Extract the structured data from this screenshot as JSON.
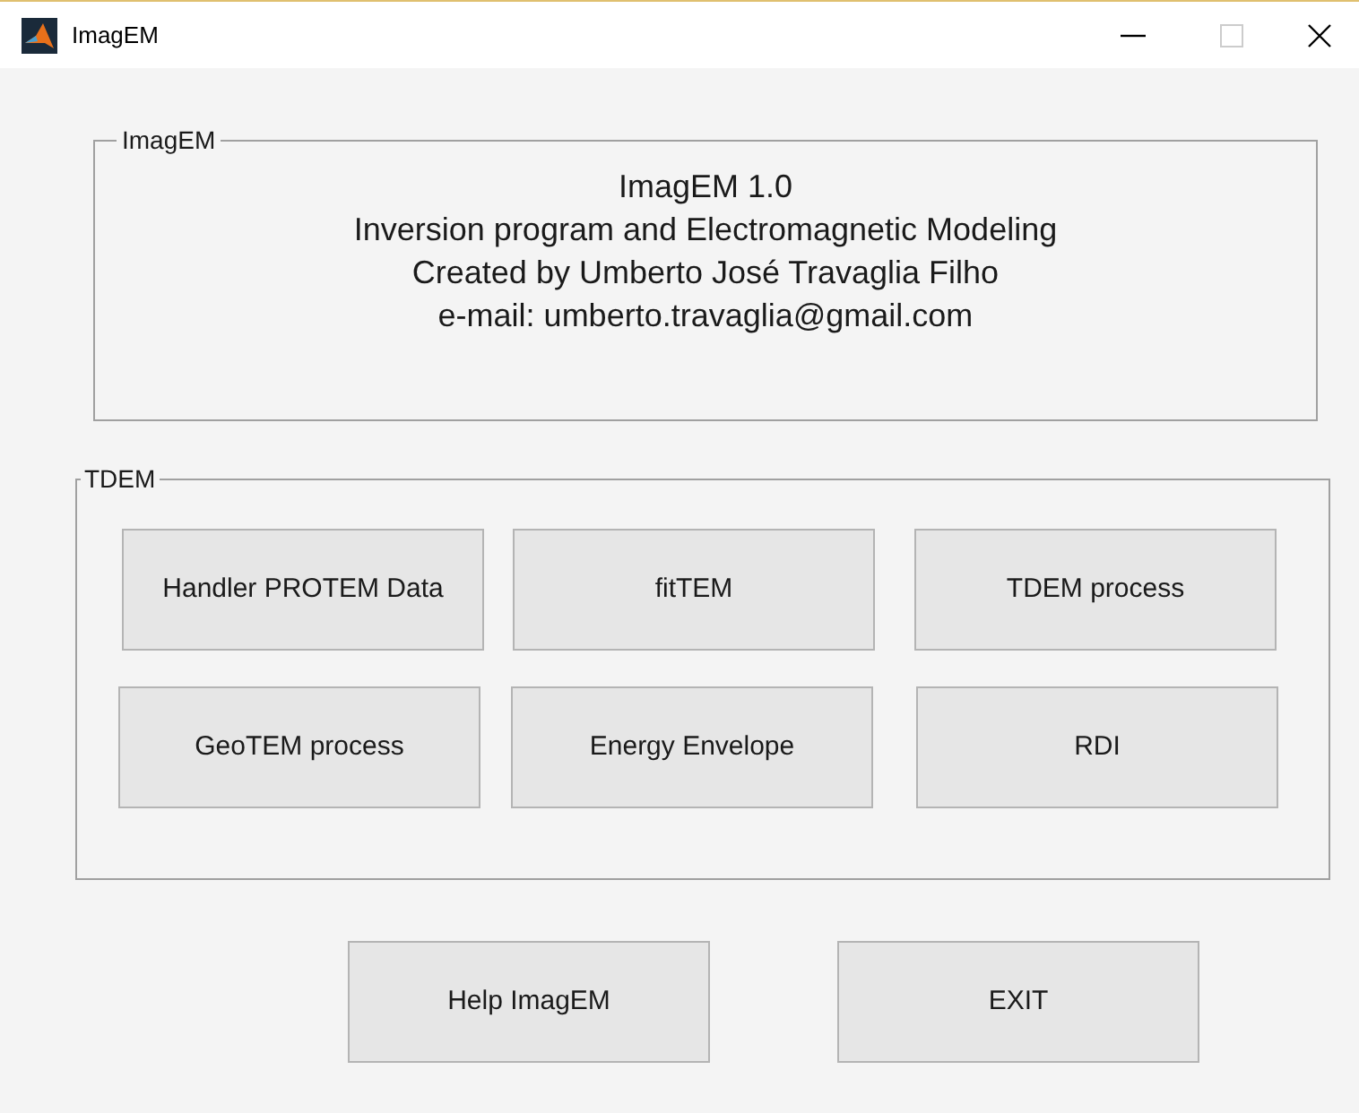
{
  "window": {
    "title": "ImagEM"
  },
  "about_panel": {
    "title": "ImagEM",
    "lines": [
      "ImagEM 1.0",
      "Inversion program and Electromagnetic Modeling",
      "Created by Umberto José Travaglia Filho",
      "e-mail: umberto.travaglia@gmail.com"
    ]
  },
  "tdem_panel": {
    "title": "TDEM",
    "buttons": [
      [
        "Handler PROTEM Data",
        "fitTEM",
        "TDEM process"
      ],
      [
        "GeoTEM process",
        "Energy Envelope",
        "RDI"
      ]
    ]
  },
  "bottom_buttons": [
    "Help ImagEM",
    "EXIT"
  ]
}
